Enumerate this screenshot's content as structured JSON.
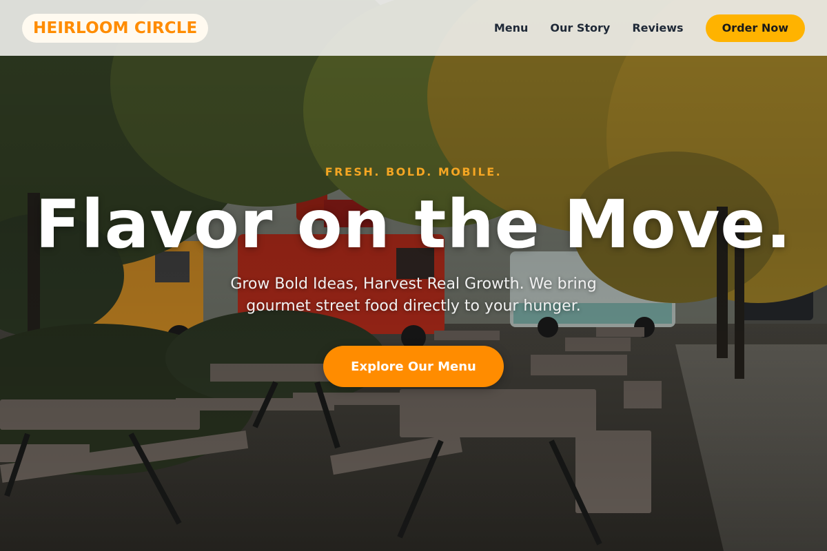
{
  "header": {
    "logo": "HEIRLOOM CIRCLE",
    "nav": [
      {
        "label": "Menu"
      },
      {
        "label": "Our Story"
      },
      {
        "label": "Reviews"
      }
    ],
    "order_button": "Order Now"
  },
  "hero": {
    "tagline": "FRESH. BOLD. MOBILE.",
    "headline": "Flavor on the Move.",
    "subtext": "Grow Bold Ideas, Harvest Real Growth. We bring gourmet street food directly to your hunger.",
    "cta": "Explore Our Menu",
    "background_image": "food-trucks-picnic-tables-photo"
  },
  "colors": {
    "brand_orange": "#ff8c00",
    "order_button_yellow": "#ffb300",
    "tagline_gold": "#f5a623",
    "nav_text": "#1f2937"
  }
}
